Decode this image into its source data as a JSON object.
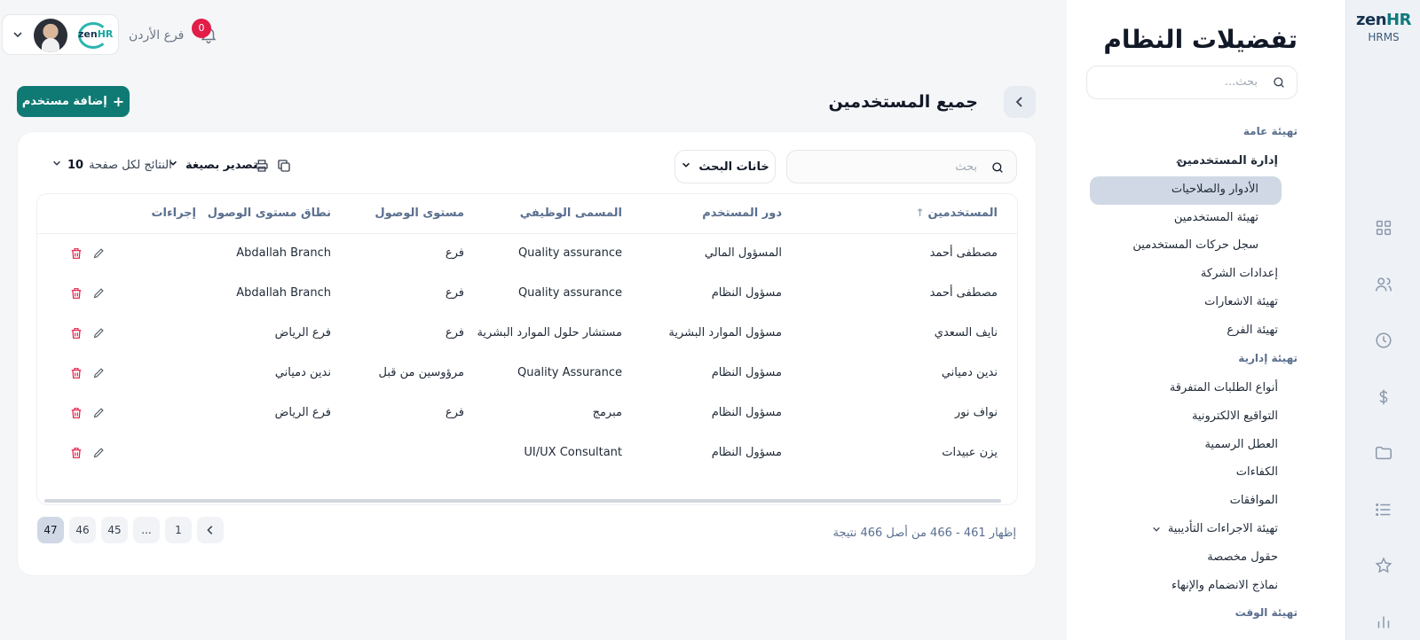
{
  "brand": {
    "name_part1": "zen",
    "name_part2": "HR",
    "product": "HRMS"
  },
  "rail": {
    "icons": [
      "grid-icon",
      "users-icon",
      "clock-icon",
      "dollar-icon",
      "folder-icon",
      "list-icon",
      "star-icon",
      "chart-icon"
    ]
  },
  "settings": {
    "title": "تفضيلات النظام",
    "search_placeholder": "بحث...",
    "groups": {
      "general": "تهيئة عامة",
      "admin": "تهيئة إدارية",
      "time": "تهيئة الوقت"
    },
    "items": {
      "user_management": "إدارة المستخدمين",
      "roles": "الأدوار والصلاحيات",
      "users_setup": "تهيئة المستخدمين",
      "users_log": "سجل حركات المستخدمين",
      "company_settings": "إعدادات الشركة",
      "notifications": "تهيئة الاشعارات",
      "branch_setup": "تهيئة الفرع",
      "misc_requests": "أنواع الطلبات المتفرقة",
      "e_signatures": "التواقيع الالكترونية",
      "holidays": "العطل الرسمية",
      "competencies": "الكفاءات",
      "approvals": "الموافقات",
      "disciplinary": "تهيئة الاجراءات التأديبية",
      "custom_fields": "حقول مخصصة",
      "onboarding_forms": "نماذج الانضمام والإنهاء"
    }
  },
  "topbar": {
    "branch": "فرع الأردن",
    "notifications_count": "0",
    "logo_text_1": "zen",
    "logo_text_2": "HR"
  },
  "page": {
    "title": "جميع المستخدمين",
    "add_button": "إضافة مستخدم"
  },
  "toolbar": {
    "search_placeholder": "بحث",
    "filter_button": "خانات البحث",
    "export_label": "تصدير بصيغة",
    "per_page_label": "النتائج لكل صفحة",
    "per_page_value": "10"
  },
  "table": {
    "headers": {
      "user": "المستخدمين",
      "role": "دور المستخدم",
      "job_title": "المسمى الوظيفي",
      "access_level": "مستوى الوصول",
      "access_scope": "نطاق مستوى الوصول",
      "actions": "إجراءات"
    },
    "rows": [
      {
        "user": "مصطفى أحمد",
        "role": "المسؤول المالي",
        "job_title": "Quality assurance",
        "access_level": "فرع",
        "access_scope": "Abdallah Branch"
      },
      {
        "user": "مصطفى أحمد",
        "role": "مسؤول النظام",
        "job_title": "Quality assurance",
        "access_level": "فرع",
        "access_scope": "Abdallah Branch"
      },
      {
        "user": "نايف السعدي",
        "role": "مسؤول الموارد البشرية",
        "job_title": "مستشار حلول الموارد البشرية",
        "access_level": "فرع",
        "access_scope": "فرع الرياض"
      },
      {
        "user": "ندين دمياني",
        "role": "مسؤول النظام",
        "job_title": "Quality Assurance",
        "access_level": "مرؤوسين من قبل",
        "access_scope": "ندين دمياني"
      },
      {
        "user": "نواف نور",
        "role": "مسؤول النظام",
        "job_title": "مبرمج",
        "access_level": "فرع",
        "access_scope": "فرع الرياض"
      },
      {
        "user": "يزن عبيدات",
        "role": "مسؤول النظام",
        "job_title": "UI/UX Consultant",
        "access_level": "",
        "access_scope": ""
      }
    ]
  },
  "footer": {
    "results_text": "إظهار 461 - 466 من أصل 466 نتيجة",
    "pages": [
      "47",
      "46",
      "45",
      "...",
      "1"
    ],
    "active_page": "47"
  }
}
